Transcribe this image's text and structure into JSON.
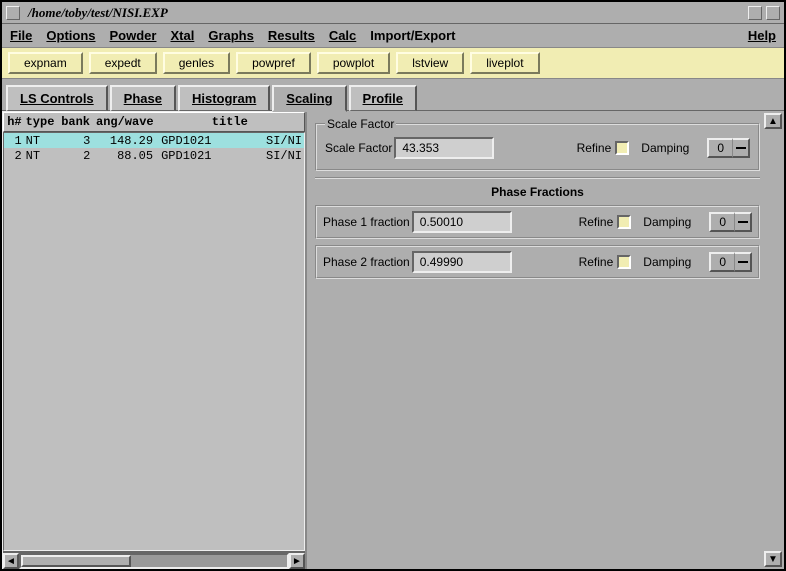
{
  "window": {
    "title": "/home/toby/test/NISI.EXP"
  },
  "menu": {
    "items": [
      "File",
      "Options",
      "Powder",
      "Xtal",
      "Graphs",
      "Results",
      "Calc",
      "Import/Export"
    ],
    "help": "Help"
  },
  "toolbar": {
    "items": [
      "expnam",
      "expedt",
      "genles",
      "powpref",
      "powplot",
      "lstview",
      "liveplot"
    ]
  },
  "tabs": {
    "items": [
      "LS Controls",
      "Phase",
      "Histogram",
      "Scaling",
      "Profile"
    ],
    "activeIndex": 3
  },
  "histlist": {
    "cols": {
      "h": "h#",
      "type": "type",
      "bank": "bank",
      "angwave": "ang/wave",
      "title": "title"
    },
    "rows": [
      {
        "h": "1",
        "type": "NT",
        "bank": "3",
        "angwave": "148.29",
        "title1": "GPD1021",
        "title2": "SI/NI",
        "selected": true
      },
      {
        "h": "2",
        "type": "NT",
        "bank": "2",
        "angwave": "88.05",
        "title1": "GPD1021",
        "title2": "SI/NI",
        "selected": false
      }
    ]
  },
  "scale": {
    "legend": "Scale Factor",
    "label": "Scale Factor",
    "value": "43.353",
    "refine": "Refine",
    "damping": "Damping",
    "dampingValue": "0"
  },
  "phaseFractions": {
    "heading": "Phase Fractions",
    "rows": [
      {
        "label": "Phase 1 fraction",
        "value": "0.50010",
        "refine": "Refine",
        "damping": "Damping",
        "dampingValue": "0"
      },
      {
        "label": "Phase 2 fraction",
        "value": "0.49990",
        "refine": "Refine",
        "damping": "Damping",
        "dampingValue": "0"
      }
    ]
  }
}
